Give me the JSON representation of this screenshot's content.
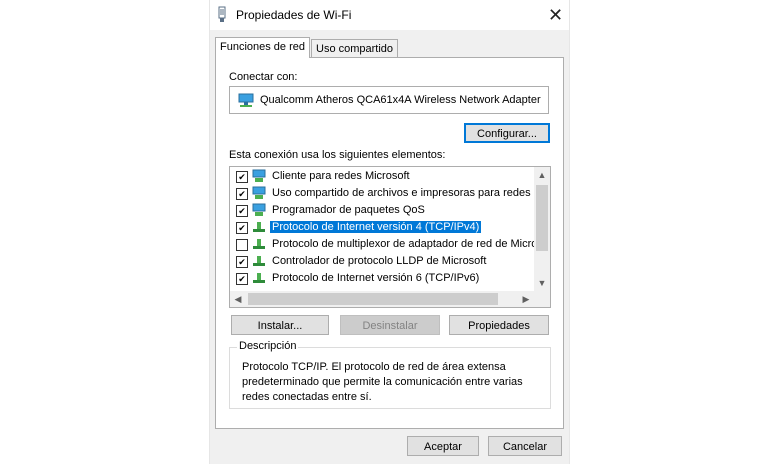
{
  "window": {
    "title": "Propiedades de Wi-Fi",
    "close_label": "✕"
  },
  "tabs": [
    {
      "label": "Funciones de red"
    },
    {
      "label": "Uso compartido"
    }
  ],
  "connect_with": {
    "label": "Conectar con:",
    "adapter": "Qualcomm Atheros QCA61x4A Wireless Network Adapter",
    "configure_label": "Configurar..."
  },
  "items_label": "Esta conexión usa los siguientes elementos:",
  "items": [
    {
      "checked": "✔",
      "label": "Cliente para redes Microsoft",
      "icon": "network-client-icon"
    },
    {
      "checked": "✔",
      "label": "Uso compartido de archivos e impresoras para redes M",
      "icon": "network-client-icon"
    },
    {
      "checked": "✔",
      "label": "Programador de paquetes QoS",
      "icon": "network-client-icon"
    },
    {
      "checked": "✔",
      "label": "Protocolo de Internet versión 4 (TCP/IPv4)",
      "icon": "protocol-icon"
    },
    {
      "checked": "",
      "label": "Protocolo de multiplexor de adaptador de red de Micros",
      "icon": "protocol-icon"
    },
    {
      "checked": "✔",
      "label": "Controlador de protocolo LLDP de Microsoft",
      "icon": "protocol-icon"
    },
    {
      "checked": "✔",
      "label": "Protocolo de Internet versión 6 (TCP/IPv6)",
      "icon": "protocol-icon"
    }
  ],
  "buttons": {
    "install": "Instalar...",
    "uninstall": "Desinstalar",
    "properties": "Propiedades",
    "accept": "Aceptar",
    "cancel": "Cancelar"
  },
  "description": {
    "title": "Descripción",
    "text": "Protocolo TCP/IP. El protocolo de red de área extensa predeterminado que permite la comunicación entre varias redes conectadas entre sí."
  },
  "colors": {
    "accent": "#0078d7",
    "dialog_bg": "#f0f0f0"
  }
}
